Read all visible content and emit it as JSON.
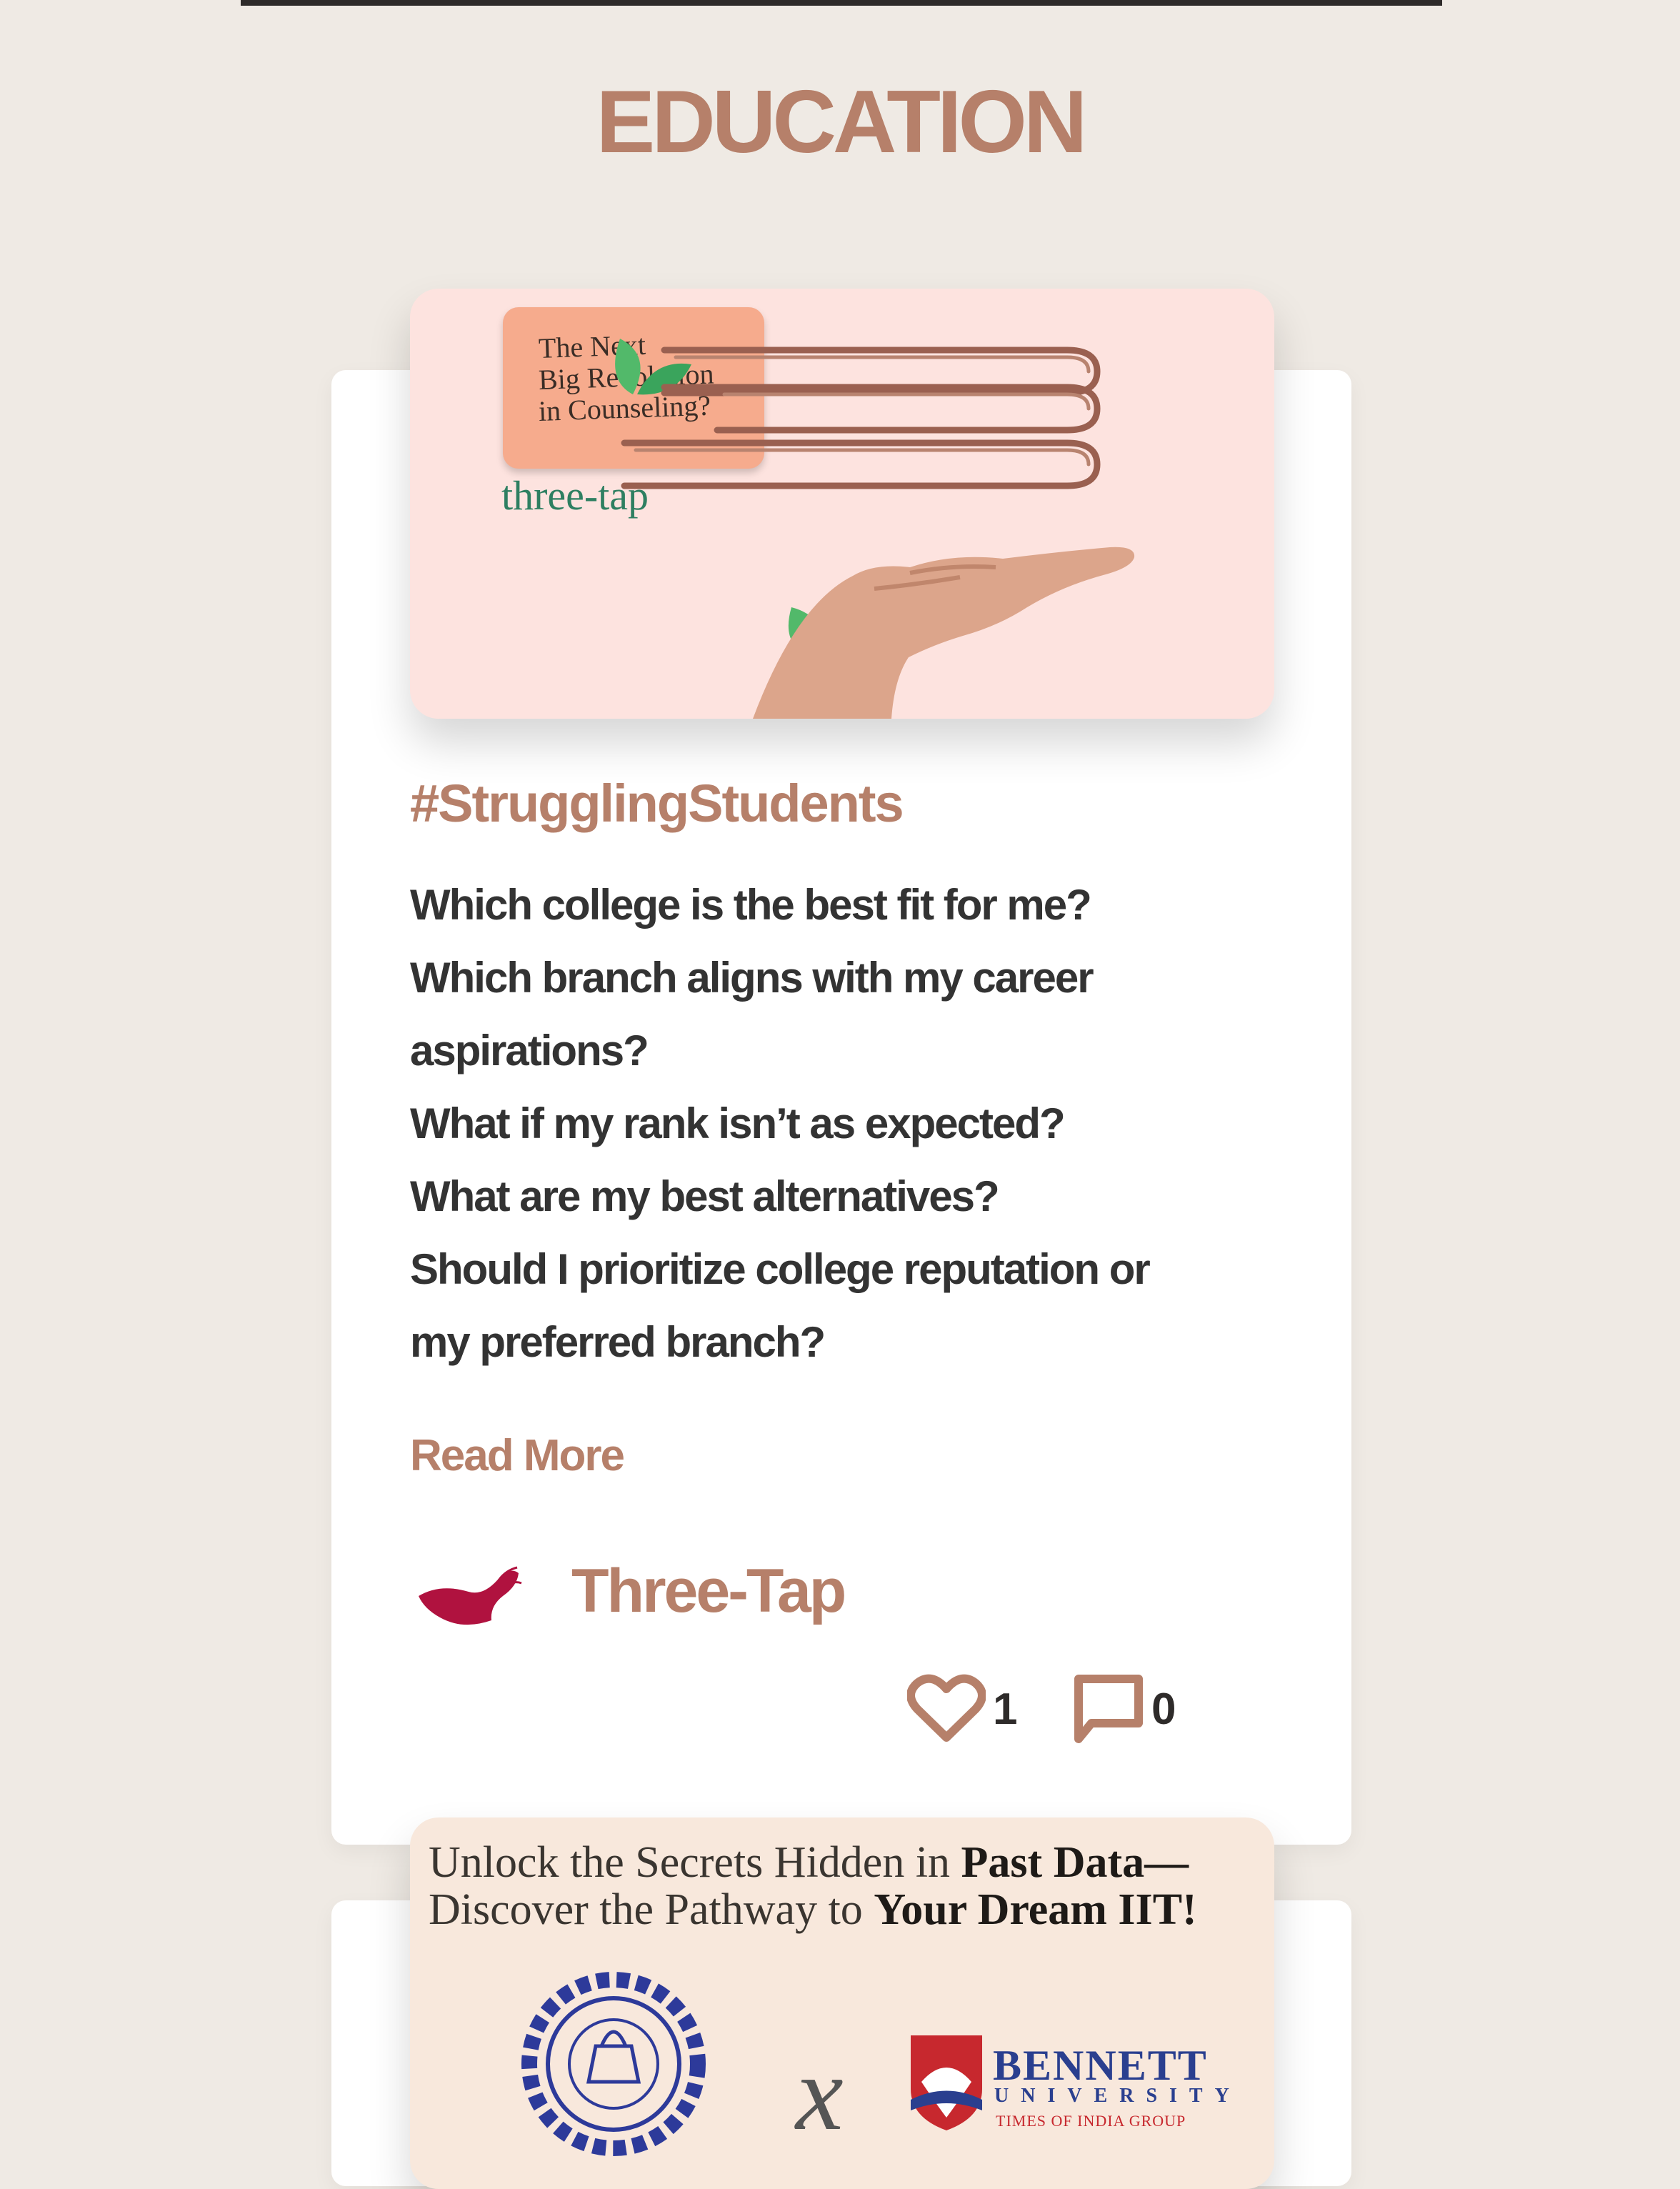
{
  "section": {
    "title": "EDUCATION"
  },
  "post1": {
    "cover": {
      "note_lines": [
        "The Next",
        "Big Revolution",
        "in Counseling?"
      ],
      "brand": "three-tap"
    },
    "hashtag": "#StrugglingStudents",
    "excerpt_lines": [
      "Which college is the best fit for me?",
      "Which branch aligns with my career",
      "aspirations?",
      "What if my rank isn’t as expected?",
      "What are my best alternatives?",
      "Should I prioritize college reputation or",
      "my preferred branch?"
    ],
    "read_more": "Read More",
    "author": {
      "name": "Three-Tap",
      "icon": "butterfly-logo-icon"
    },
    "likes": "1",
    "comments": "0"
  },
  "post2": {
    "cover": {
      "line1_plain": "Unlock the Secrets Hidden in ",
      "line1_bold": "Past Data—",
      "line2_plain": "Discover the Pathway to ",
      "line2_bold": "Your Dream IIT!",
      "partner_name": "BENNETT",
      "partner_sub": "UNIVERSITY",
      "partner_group": "TIMES OF INDIA GROUP"
    }
  },
  "colors": {
    "background": "#efeae4",
    "accent": "#b6806a",
    "text": "#333333",
    "brand_crimson": "#b0123f"
  }
}
